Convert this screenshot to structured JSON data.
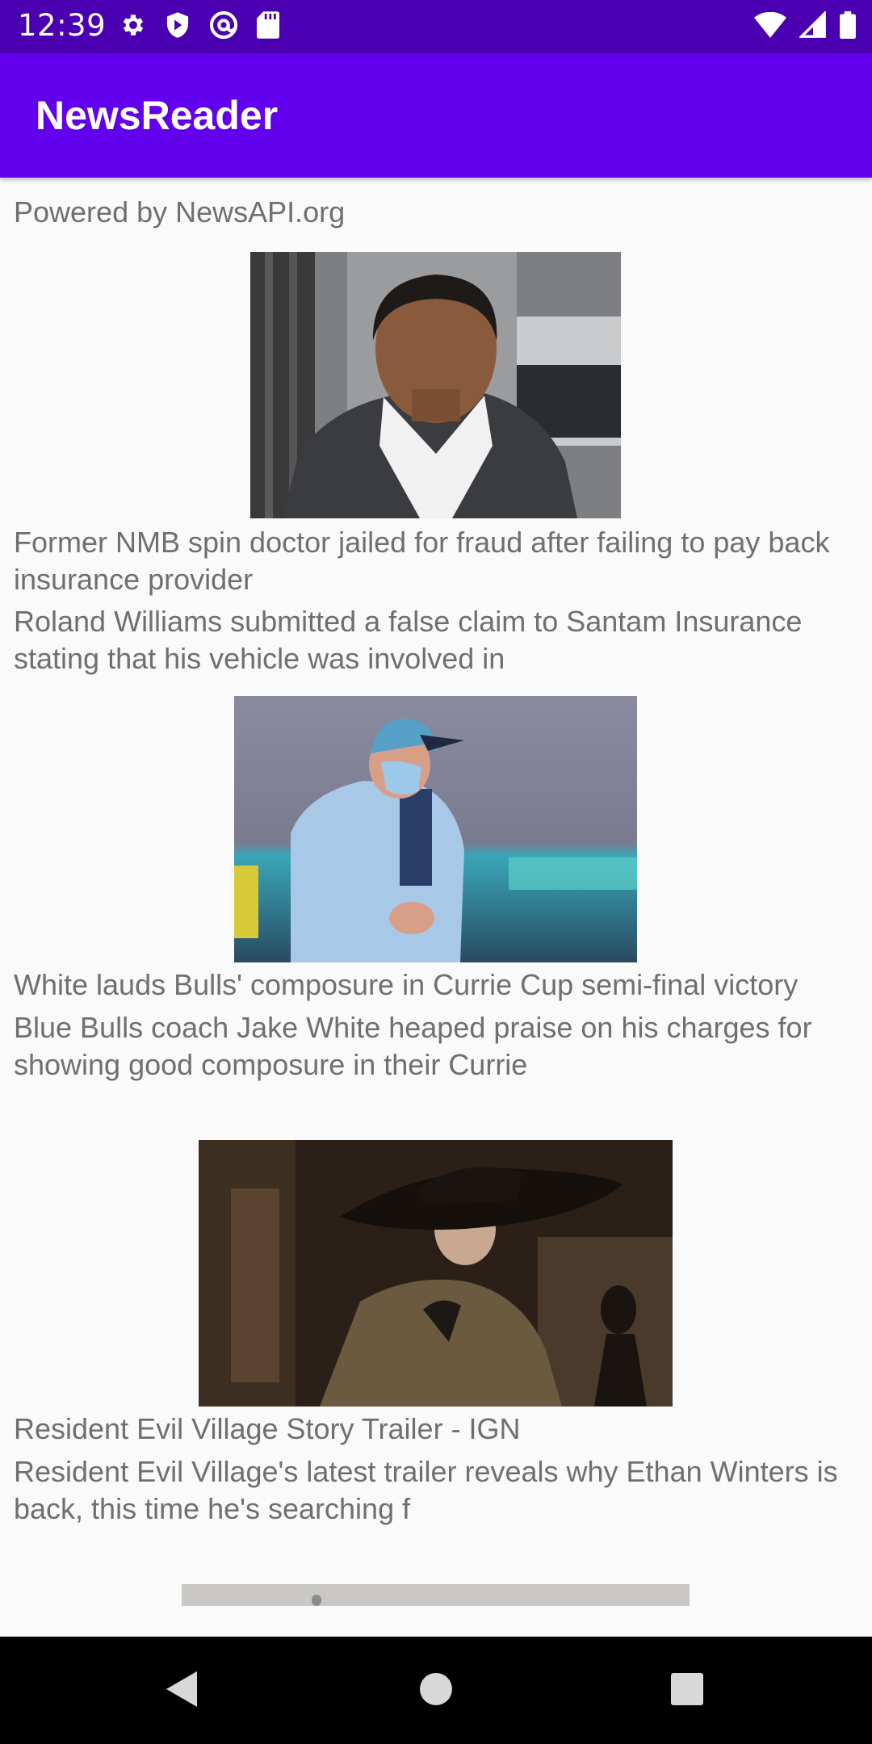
{
  "status_bar": {
    "time": "12:39",
    "left_icons": [
      "gear-icon",
      "shield-icon",
      "at-sign-icon",
      "sd-card-icon"
    ],
    "right_icons": [
      "wifi-icon",
      "cell-signal-icon",
      "battery-icon"
    ]
  },
  "app_bar": {
    "title": "NewsReader",
    "color": "#6200ee",
    "status_color": "#4a00b0"
  },
  "attribution": "Powered by NewsAPI.org",
  "articles": [
    {
      "image": "photo-man-in-suit",
      "title": "Former NMB spin doctor jailed for fraud after failing to pay back insurance provider",
      "description": "Roland Williams submitted a false claim to Santam Insurance stating that his vehicle was involved in"
    },
    {
      "image": "photo-coach-in-mask",
      "title": "White lauds Bulls' composure in Currie Cup semi-final victory",
      "description": "Blue Bulls coach Jake White heaped praise on his charges for showing good composure in their Currie"
    },
    {
      "image": "photo-woman-in-hat",
      "title": "Resident Evil Village Story Trailer - IGN",
      "description": "Resident Evil Village's latest trailer reveals why Ethan Winters is back, this time he's searching f"
    },
    {
      "image": "photo-partially-loaded",
      "title": "",
      "description": ""
    }
  ],
  "nav_bar": {
    "buttons": [
      "back-icon",
      "home-icon",
      "recents-icon"
    ]
  }
}
